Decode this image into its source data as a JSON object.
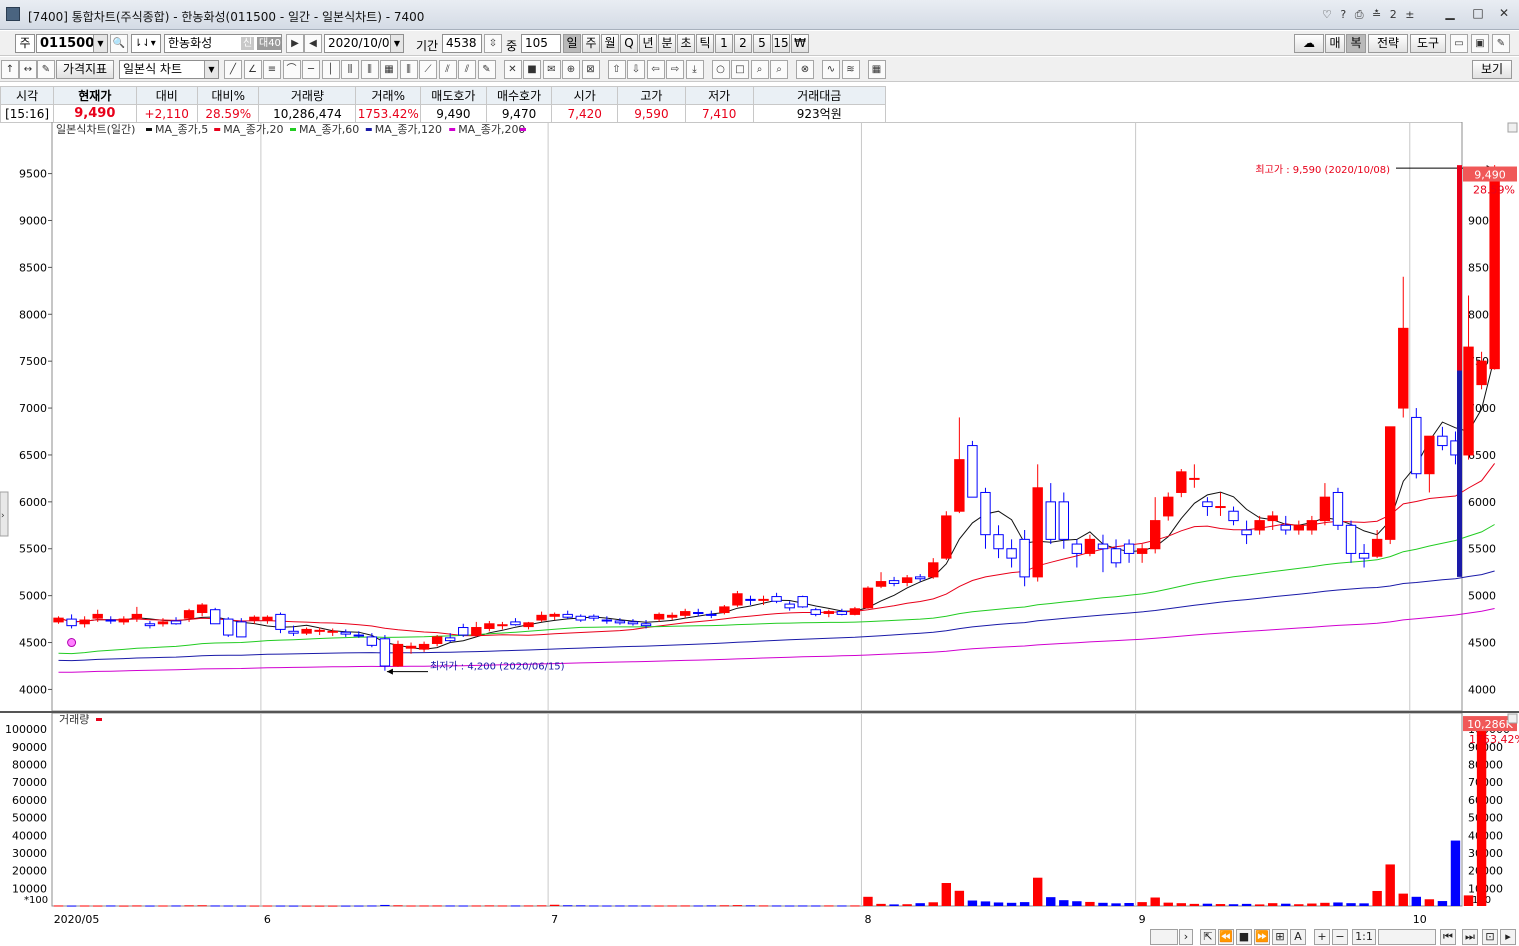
{
  "window": {
    "title": "[7400] 통합차트(주식종합) - 한농화성(011500 - 일간 - 일본식차트) - 7400",
    "title_icons": "♡ ? ⎙ ≛ 2 ±"
  },
  "toolbar1": {
    "market": "주",
    "code": "011500",
    "name": "한농화성",
    "credit_badge": "신",
    "margin_badge": "대40",
    "date": "2020/10/08",
    "period_label": "기간",
    "period_value": "4538",
    "count_label": "중",
    "count_value": "105",
    "timeframes": [
      "일",
      "주",
      "월",
      "Q",
      "년",
      "분",
      "초",
      "틱",
      "1",
      "2",
      "5",
      "15",
      "₩"
    ],
    "selected_timeframe": "일",
    "right_buttons": [
      "매",
      "복",
      "전략",
      "도구"
    ]
  },
  "toolbar2": {
    "indicator_label": "가격지표",
    "chart_type": "일본식 차트",
    "view_button": "보기"
  },
  "quote": {
    "headers": [
      "시각",
      "현재가",
      "대비",
      "대비%",
      "거래량",
      "거래%",
      "매도호가",
      "매수호가",
      "시가",
      "고가",
      "저가",
      "거래대금"
    ],
    "values": [
      "[15:16]",
      "9,490",
      "+2,110",
      "28.59%",
      "10,286,474",
      "1753.42%",
      "9,490",
      "9,470",
      "7,420",
      "9,590",
      "7,410",
      "923억원"
    ]
  },
  "chart_data": {
    "type": "candlestick",
    "legend": "일본식차트(일간)",
    "ma_series": [
      {
        "name": "MA_종가,5",
        "color": "#111111"
      },
      {
        "name": "MA_종가,20",
        "color": "#e8001a"
      },
      {
        "name": "MA_종가,60",
        "color": "#22cc22"
      },
      {
        "name": "MA_종가,120",
        "color": "#1a1aa8"
      },
      {
        "name": "MA_종가,200",
        "color": "#d000d0"
      }
    ],
    "y_ticks": [
      4000,
      4500,
      5000,
      5500,
      6000,
      6500,
      7000,
      7500,
      8000,
      8500,
      9000,
      9500
    ],
    "ylim": [
      3770,
      10050
    ],
    "x_ticks": [
      {
        "label": "2020/05",
        "index": -0.6
      },
      {
        "label": "6",
        "index": 15.5
      },
      {
        "label": "7",
        "index": 37.5
      },
      {
        "label": "8",
        "index": 61.5
      },
      {
        "label": "9",
        "index": 82.5
      },
      {
        "label": "10",
        "index": 103.5
      }
    ],
    "bar_count": 108,
    "candles": [
      [
        4720,
        4780,
        4700,
        4760
      ],
      [
        4750,
        4800,
        4650,
        4680
      ],
      [
        4700,
        4780,
        4660,
        4740
      ],
      [
        4760,
        4850,
        4720,
        4800
      ],
      [
        4740,
        4780,
        4700,
        4730
      ],
      [
        4720,
        4780,
        4690,
        4750
      ],
      [
        4760,
        4880,
        4720,
        4800
      ],
      [
        4700,
        4730,
        4650,
        4680
      ],
      [
        4700,
        4760,
        4670,
        4720
      ],
      [
        4730,
        4770,
        4690,
        4700
      ],
      [
        4760,
        4860,
        4720,
        4840
      ],
      [
        4820,
        4920,
        4780,
        4900
      ],
      [
        4850,
        4870,
        4700,
        4700
      ],
      [
        4750,
        4770,
        4560,
        4580
      ],
      [
        4720,
        4760,
        4560,
        4560
      ],
      [
        4740,
        4790,
        4700,
        4770
      ],
      [
        4740,
        4790,
        4700,
        4770
      ],
      [
        4800,
        4820,
        4600,
        4640
      ],
      [
        4620,
        4680,
        4570,
        4600
      ],
      [
        4600,
        4660,
        4580,
        4640
      ],
      [
        4620,
        4660,
        4580,
        4630
      ],
      [
        4610,
        4650,
        4570,
        4620
      ],
      [
        4610,
        4640,
        4560,
        4590
      ],
      [
        4580,
        4620,
        4550,
        4570
      ],
      [
        4560,
        4600,
        4450,
        4470
      ],
      [
        4540,
        4580,
        4200,
        4250
      ],
      [
        4250,
        4520,
        4240,
        4480
      ],
      [
        4440,
        4500,
        4380,
        4460
      ],
      [
        4430,
        4510,
        4400,
        4480
      ],
      [
        4490,
        4580,
        4460,
        4560
      ],
      [
        4550,
        4600,
        4500,
        4520
      ],
      [
        4660,
        4700,
        4560,
        4580
      ],
      [
        4580,
        4720,
        4560,
        4660
      ],
      [
        4650,
        4730,
        4620,
        4700
      ],
      [
        4680,
        4720,
        4640,
        4690
      ],
      [
        4720,
        4760,
        4680,
        4690
      ],
      [
        4670,
        4720,
        4640,
        4710
      ],
      [
        4740,
        4830,
        4720,
        4790
      ],
      [
        4780,
        4820,
        4740,
        4800
      ],
      [
        4800,
        4840,
        4750,
        4770
      ],
      [
        4780,
        4800,
        4720,
        4740
      ],
      [
        4780,
        4800,
        4730,
        4760
      ],
      [
        4740,
        4780,
        4700,
        4730
      ],
      [
        4730,
        4760,
        4690,
        4710
      ],
      [
        4720,
        4750,
        4680,
        4700
      ],
      [
        4700,
        4740,
        4650,
        4680
      ],
      [
        4750,
        4820,
        4720,
        4800
      ],
      [
        4770,
        4820,
        4740,
        4790
      ],
      [
        4790,
        4860,
        4760,
        4830
      ],
      [
        4820,
        4860,
        4780,
        4810
      ],
      [
        4800,
        4840,
        4760,
        4790
      ],
      [
        4820,
        4900,
        4800,
        4880
      ],
      [
        4900,
        5050,
        4880,
        5020
      ],
      [
        4960,
        5000,
        4900,
        4950
      ],
      [
        4950,
        5000,
        4900,
        4960
      ],
      [
        4990,
        5030,
        4920,
        4940
      ],
      [
        4910,
        4940,
        4840,
        4870
      ],
      [
        4990,
        5000,
        4870,
        4880
      ],
      [
        4850,
        4870,
        4780,
        4800
      ],
      [
        4810,
        4850,
        4770,
        4830
      ],
      [
        4830,
        4860,
        4790,
        4800
      ],
      [
        4800,
        4880,
        4790,
        4860
      ],
      [
        4870,
        5100,
        4860,
        5080
      ],
      [
        5100,
        5250,
        5080,
        5150
      ],
      [
        5160,
        5200,
        5100,
        5130
      ],
      [
        5140,
        5220,
        5100,
        5190
      ],
      [
        5200,
        5230,
        5150,
        5180
      ],
      [
        5200,
        5400,
        5180,
        5350
      ],
      [
        5400,
        5900,
        5380,
        5850
      ],
      [
        5900,
        6900,
        5880,
        6450
      ],
      [
        6600,
        6650,
        6050,
        6050
      ],
      [
        6100,
        6150,
        5500,
        5650
      ],
      [
        5650,
        5750,
        5400,
        5500
      ],
      [
        5500,
        5600,
        5300,
        5400
      ],
      [
        5600,
        5700,
        5100,
        5200
      ],
      [
        5200,
        6400,
        5150,
        6150
      ],
      [
        6000,
        6200,
        5550,
        5600
      ],
      [
        6000,
        6100,
        5500,
        5600
      ],
      [
        5550,
        5600,
        5300,
        5450
      ],
      [
        5450,
        5650,
        5420,
        5600
      ],
      [
        5550,
        5650,
        5250,
        5500
      ],
      [
        5500,
        5600,
        5300,
        5350
      ],
      [
        5550,
        5600,
        5350,
        5450
      ],
      [
        5450,
        5550,
        5350,
        5500
      ],
      [
        5500,
        6050,
        5450,
        5800
      ],
      [
        5850,
        6100,
        5800,
        6050
      ],
      [
        6100,
        6350,
        6050,
        6320
      ],
      [
        6250,
        6400,
        6150,
        6250
      ],
      [
        6000,
        6050,
        5850,
        5950
      ],
      [
        5950,
        6100,
        5850,
        5950
      ],
      [
        5900,
        5950,
        5750,
        5800
      ],
      [
        5700,
        5800,
        5550,
        5650
      ],
      [
        5700,
        5850,
        5650,
        5800
      ],
      [
        5800,
        5900,
        5700,
        5850
      ],
      [
        5750,
        5850,
        5650,
        5700
      ],
      [
        5700,
        5800,
        5650,
        5750
      ],
      [
        5700,
        5850,
        5650,
        5800
      ],
      [
        5800,
        6200,
        5750,
        6050
      ],
      [
        6100,
        6150,
        5700,
        5750
      ],
      [
        5750,
        5800,
        5350,
        5450
      ],
      [
        5450,
        5550,
        5300,
        5400
      ],
      [
        5420,
        5700,
        5400,
        5600
      ],
      [
        5600,
        6800,
        5550,
        6800
      ],
      [
        7000,
        8400,
        6900,
        7850
      ],
      [
        6900,
        7000,
        6250,
        6300
      ],
      [
        6300,
        6650,
        6100,
        6700
      ],
      [
        6700,
        6800,
        6550,
        6600
      ],
      [
        6650,
        6750,
        6400,
        6500
      ],
      [
        6500,
        8200,
        6450,
        7650
      ],
      [
        7250,
        7600,
        7200,
        7500
      ],
      [
        7420,
        9590,
        7410,
        9490
      ]
    ],
    "volume_ticks": [
      10000,
      20000,
      30000,
      40000,
      50000,
      60000,
      70000,
      80000,
      90000,
      100000
    ],
    "volume_label": "거래량",
    "volume_unit": "*100",
    "volume_ylim": [
      0,
      108000
    ],
    "volumes": [
      300,
      250,
      280,
      260,
      300,
      240,
      320,
      260,
      280,
      300,
      380,
      420,
      300,
      280,
      260,
      250,
      270,
      260,
      240,
      230,
      220,
      230,
      240,
      260,
      300,
      600,
      400,
      280,
      300,
      320,
      300,
      280,
      300,
      350,
      300,
      310,
      320,
      380,
      700,
      420,
      380,
      300,
      280,
      300,
      310,
      300,
      280,
      300,
      320,
      300,
      350,
      400,
      500,
      380,
      330,
      300,
      280,
      300,
      290,
      320,
      300,
      320,
      5200,
      1200,
      900,
      1000,
      1600,
      2100,
      13000,
      8600,
      3100,
      2600,
      2000,
      1800,
      2200,
      16000,
      5000,
      3300,
      2700,
      2300,
      1800,
      1500,
      1700,
      2200,
      4800,
      1900,
      1600,
      1200,
      1300,
      1100,
      1000,
      1200,
      900,
      1600,
      1300,
      1000,
      1400,
      1800,
      2000,
      1600,
      1500,
      8500,
      23500,
      7000,
      5200,
      3800,
      2800,
      37000,
      6000,
      102866
    ],
    "high_annotation": "최고가 : 9,590 (2020/10/08)",
    "low_annotation": "최저가 : 4,200 (2020/06/15)",
    "last_price": "9,490",
    "last_change": "28.59%",
    "last_volume": "10,286K",
    "last_volume_ratio": "1753.42%",
    "up_color": "#ff0000",
    "down_color": "#0000ff"
  },
  "bottom_bar": {
    "zoom": "1:1"
  }
}
